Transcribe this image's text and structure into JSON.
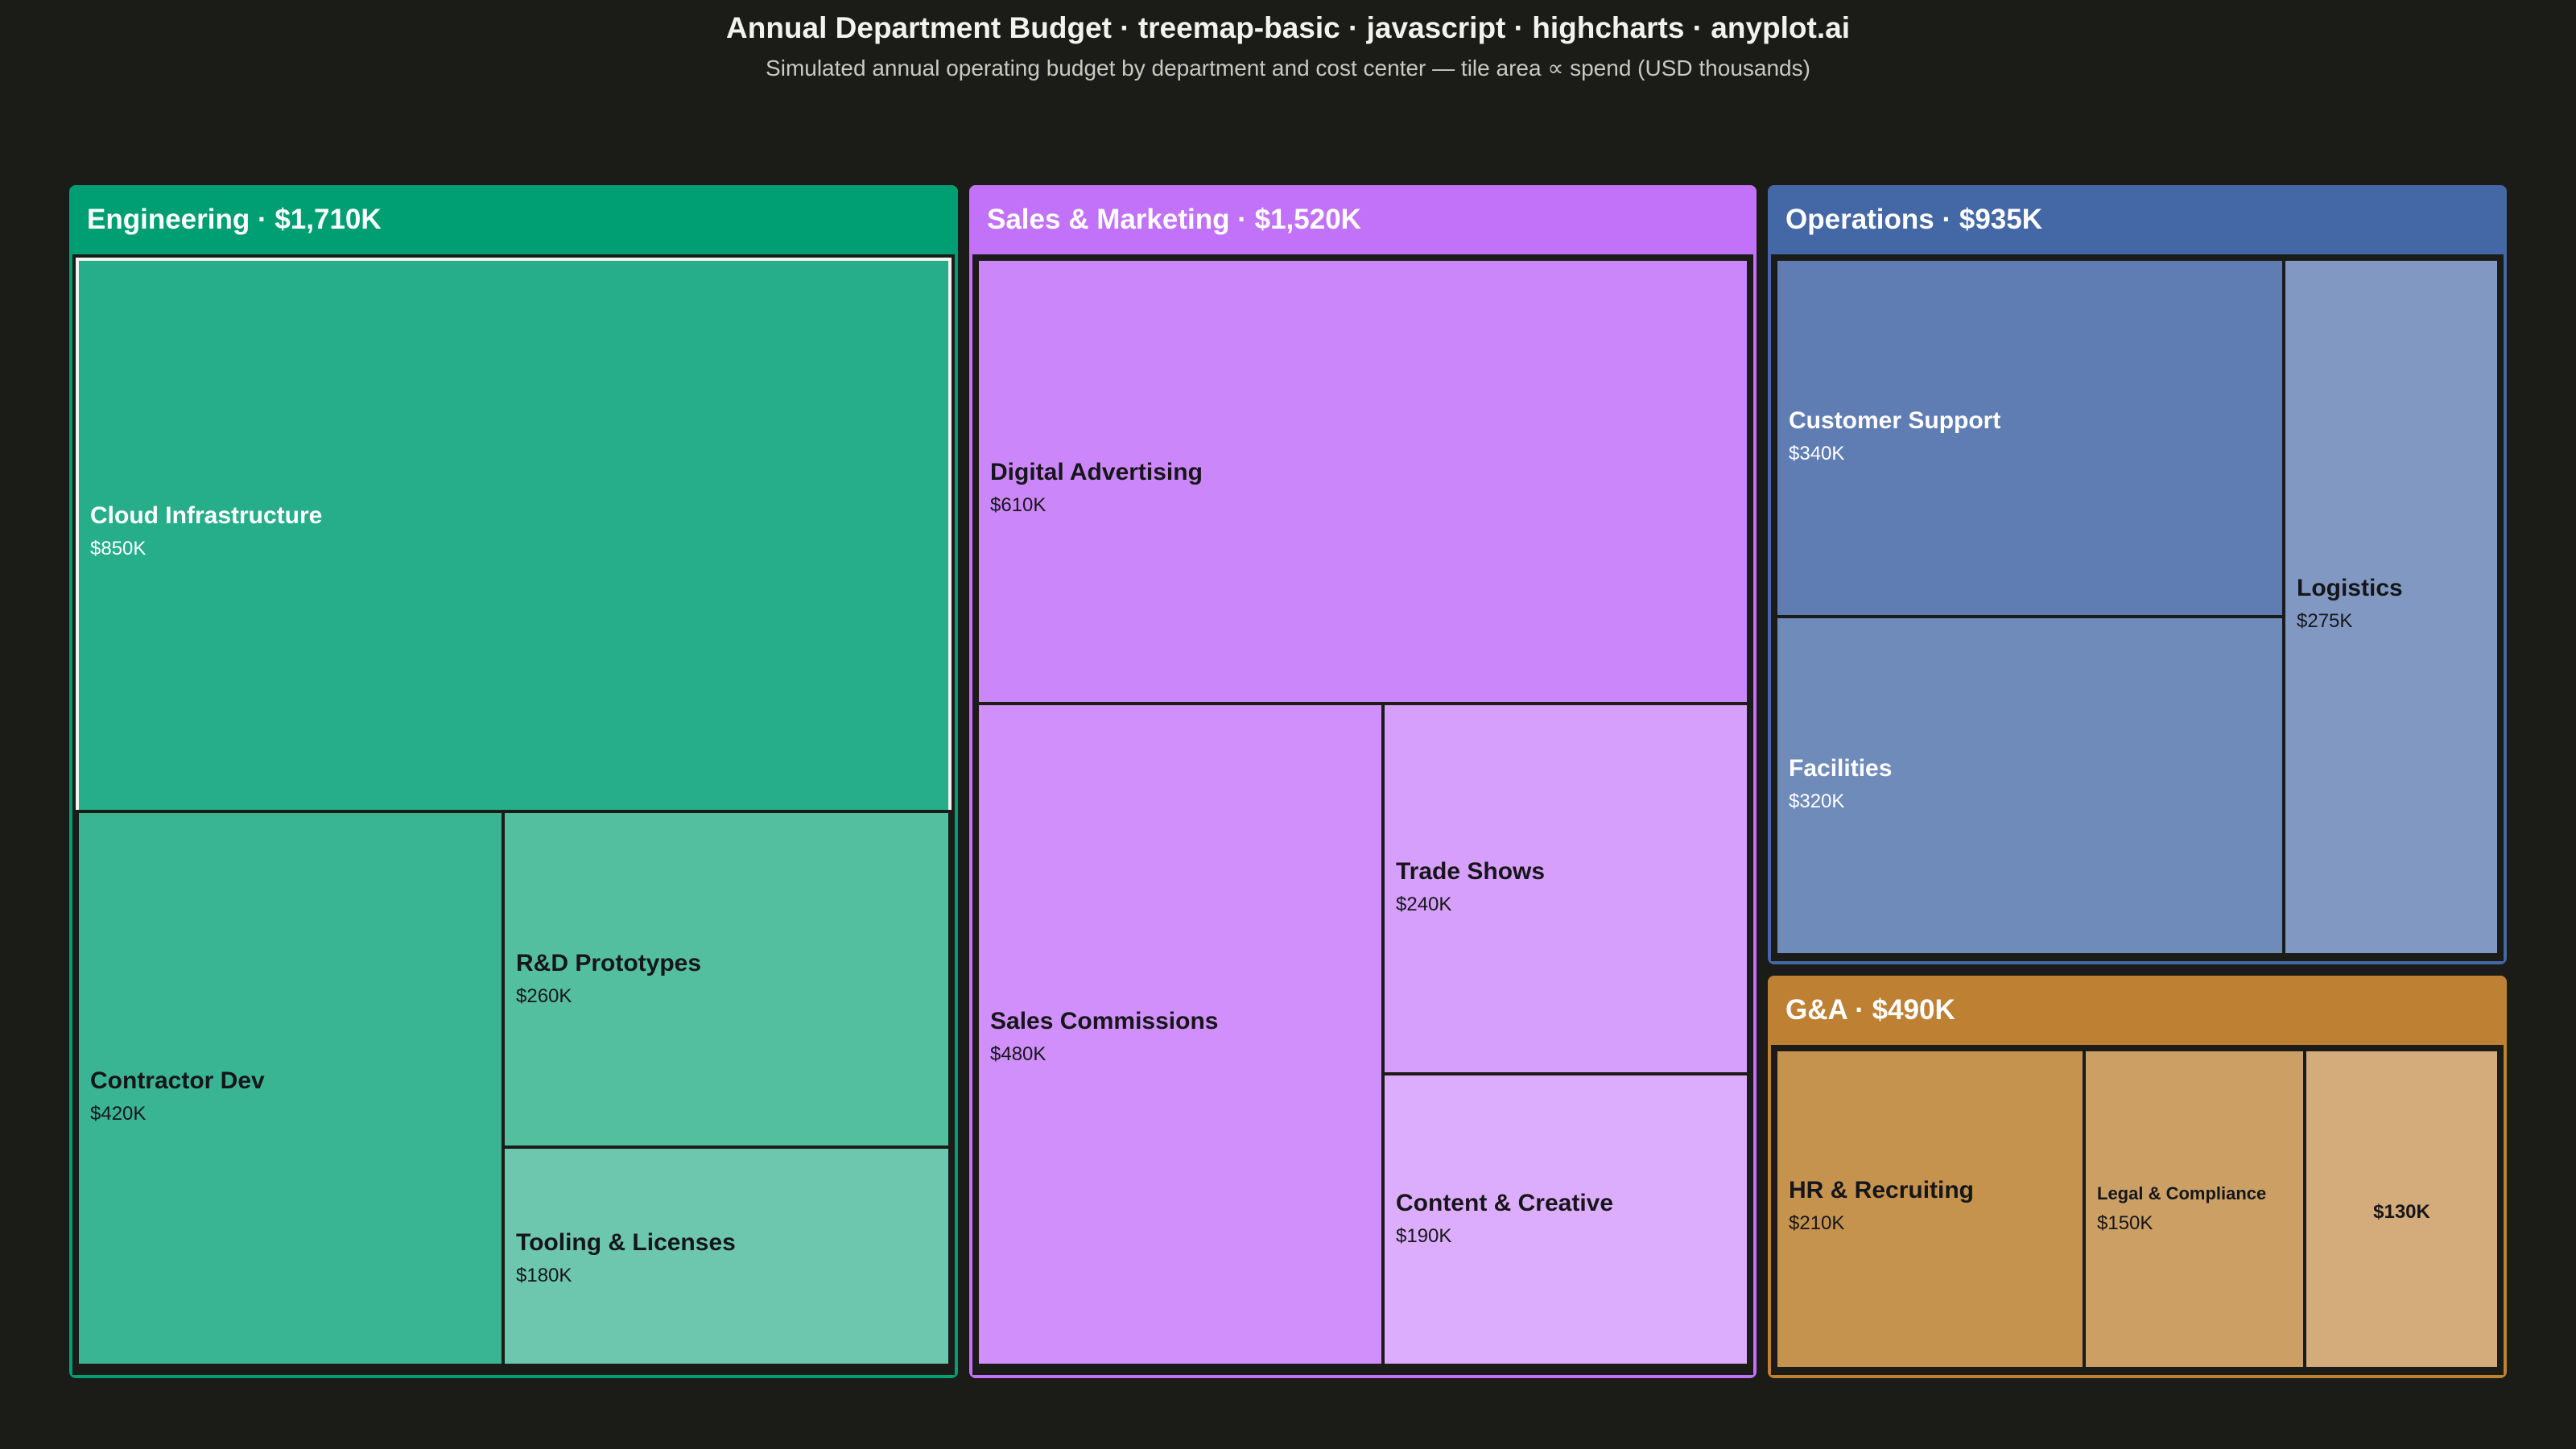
{
  "title": "Annual Department Budget · treemap-basic · javascript · highcharts · anyplot.ai",
  "subtitle": "Simulated annual operating budget by department and cost center — tile area ∝ spend (USD thousands)",
  "colors": {
    "background": "#1b1b18",
    "engineering": "#009e73",
    "sales_marketing": "#c172f8",
    "operations": "#4467a6",
    "ga": "#be8033"
  },
  "chart_data": {
    "type": "treemap",
    "title": "Annual Department Budget · treemap-basic · javascript · highcharts · anyplot.ai",
    "subtitle": "Simulated annual operating budget by department and cost center — tile area ∝ spend (USD thousands)",
    "departments": [
      {
        "name": "Engineering",
        "label": "Engineering · $1,710K",
        "value": 1710,
        "children": [
          {
            "name": "Cloud Infrastructure",
            "value": 850,
            "label": "$850K"
          },
          {
            "name": "Contractor Dev",
            "value": 420,
            "label": "$420K"
          },
          {
            "name": "R&D Prototypes",
            "value": 260,
            "label": "$260K"
          },
          {
            "name": "Tooling & Licenses",
            "value": 180,
            "label": "$180K"
          }
        ]
      },
      {
        "name": "Sales & Marketing",
        "label": "Sales & Marketing · $1,520K",
        "value": 1520,
        "children": [
          {
            "name": "Digital Advertising",
            "value": 610,
            "label": "$610K"
          },
          {
            "name": "Sales Commissions",
            "value": 480,
            "label": "$480K"
          },
          {
            "name": "Trade Shows",
            "value": 240,
            "label": "$240K"
          },
          {
            "name": "Content & Creative",
            "value": 190,
            "label": "$190K"
          }
        ]
      },
      {
        "name": "Operations",
        "label": "Operations · $935K",
        "value": 935,
        "children": [
          {
            "name": "Customer Support",
            "value": 340,
            "label": "$340K"
          },
          {
            "name": "Facilities",
            "value": 320,
            "label": "$320K"
          },
          {
            "name": "Logistics",
            "value": 275,
            "label": "$275K"
          }
        ]
      },
      {
        "name": "G&A",
        "label": "G&A · $490K",
        "value": 490,
        "children": [
          {
            "name": "HR & Recruiting",
            "value": 210,
            "label": "$210K"
          },
          {
            "name": "Legal & Compliance",
            "value": 150,
            "label": "$150K"
          },
          {
            "name": "",
            "value": 130,
            "label": "$130K"
          }
        ]
      }
    ]
  }
}
